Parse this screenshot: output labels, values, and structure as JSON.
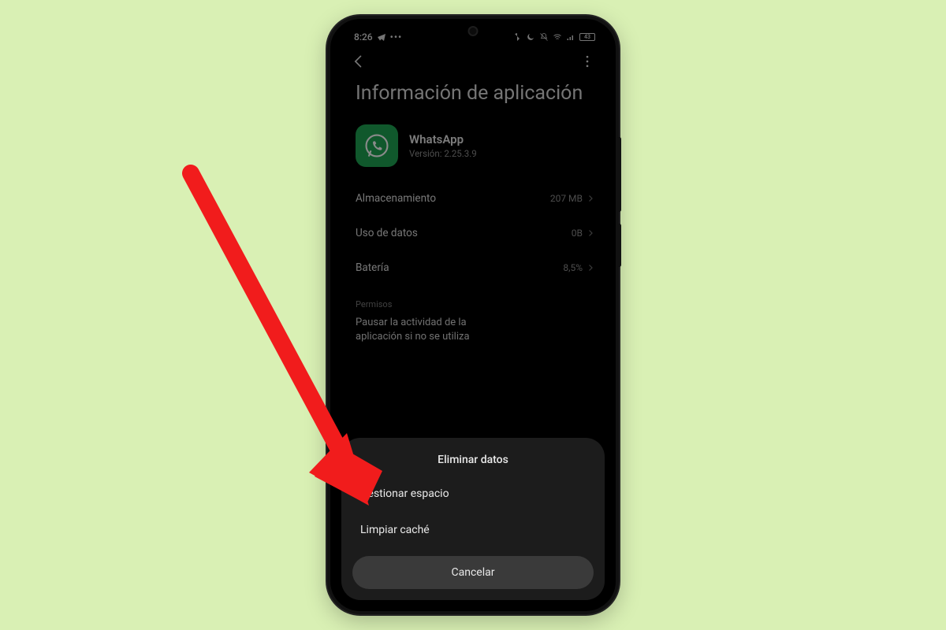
{
  "status": {
    "time": "8:26",
    "batt_text": "43"
  },
  "page_title": "Información de aplicación",
  "app": {
    "name": "WhatsApp",
    "version_label": "Versión: 2.25.3.9"
  },
  "rows": {
    "storage": {
      "label": "Almacenamiento",
      "value": "207 MB"
    },
    "data": {
      "label": "Uso de datos",
      "value": "0B"
    },
    "battery": {
      "label": "Batería",
      "value": "8,5%"
    }
  },
  "permissions_header": "Permisos",
  "pause_text": "Pausar la actividad de la aplicación si no se utiliza",
  "sheet": {
    "title": "Eliminar datos",
    "manage_space": "Gestionar espacio",
    "clear_cache": "Limpiar caché",
    "cancel": "Cancelar"
  }
}
